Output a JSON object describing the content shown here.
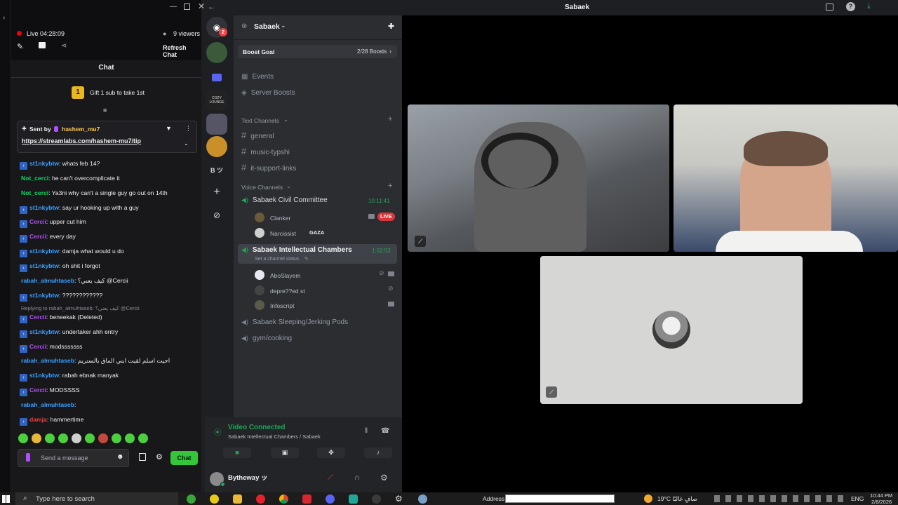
{
  "window": {
    "title": "Sabaek",
    "back_icon": "arrow-left-icon"
  },
  "twitch": {
    "live_label": "Live 04:28:09",
    "viewers": "9 viewers",
    "refresh_chat": "Refresh Chat",
    "chat_header": "Chat",
    "gift_rank": "1",
    "gift_text": "Gift 1 sub to take 1st",
    "pinned": {
      "sent_by": "Sent by",
      "user": "hashem_mu7",
      "link": "https://streamlabs.com/hashem-mu7/tip"
    },
    "messages": [
      {
        "user": "st1nkybtw",
        "color": "blue",
        "badge": true,
        "text": ": whats feb 14?"
      },
      {
        "user": "Not_cerci",
        "color": "green",
        "badge": false,
        "text": ": he can't overcomplicate it"
      },
      {
        "user": "Not_cerci",
        "color": "green",
        "badge": false,
        "text": ": Ya3ni why can't a single guy go out on 14th"
      },
      {
        "user": "st1nkybtw",
        "color": "blue",
        "badge": true,
        "text": ": say ur hooking up with a guy"
      },
      {
        "user": "Cercii",
        "color": "purple",
        "badge": true,
        "text": ": upper cut him"
      },
      {
        "user": "Cercii",
        "color": "purple",
        "badge": true,
        "text": ": every day"
      },
      {
        "user": "st1nkybtw",
        "color": "blue",
        "badge": true,
        "text": ": damja what would u do"
      },
      {
        "user": "st1nkybtw",
        "color": "blue",
        "badge": true,
        "text": ": oh shit i forgot"
      },
      {
        "user": "rabah_almuhtaseb",
        "color": "blue",
        "badge": false,
        "text": ": كيف يعني؟ @Cercii"
      },
      {
        "user": "st1nkybtw",
        "color": "blue",
        "badge": true,
        "text": ": ????????????"
      },
      {
        "user": "Cercii",
        "color": "purple",
        "badge": true,
        "text": ": beneekak (Deleted)"
      },
      {
        "user": "st1nkybtw",
        "color": "blue",
        "badge": true,
        "text": ": undertaker ahh entry"
      },
      {
        "user": "Cercii",
        "color": "purple",
        "badge": true,
        "text": ": modsssssss"
      },
      {
        "user": "rabah_almuhtaseb",
        "color": "blue",
        "badge": false,
        "text": ": اجيت اسلم لقيت ابني الماق بالستريم"
      },
      {
        "user": "st1nkybtw",
        "color": "blue",
        "badge": true,
        "text": ": rabah ebnak manyak"
      },
      {
        "user": "Cercii",
        "color": "purple",
        "badge": true,
        "text": ": MODSSSS"
      },
      {
        "user": "rabah_almuhtaseb",
        "color": "blue",
        "badge": false,
        "text": ":"
      },
      {
        "user": "damja",
        "color": "red",
        "badge": true,
        "text": ": hammertime"
      }
    ],
    "reply_note": "Replying to rabah_almuhtaseb: كيف يعني؟ @Cercii",
    "input_placeholder": "Send a message",
    "chat_button": "Chat"
  },
  "rail": {
    "discord_badge": "2",
    "server_text": "B ツ",
    "cozy_label": "COZY LOUNGE"
  },
  "channels": {
    "server_name": "Sabaek",
    "boost_goal": "Boost Goal",
    "boost_count": "2/28 Boosts",
    "events": "Events",
    "server_boosts": "Server Boosts",
    "text_header": "Text Channels",
    "text": [
      "general",
      "music-typshi",
      "it-support-links"
    ],
    "voice_header": "Voice Channels",
    "vc1": {
      "name": "Sabaek Civil Committee",
      "time": "10:11:41",
      "users": [
        {
          "name": "Clanker",
          "live": "LIVE"
        },
        {
          "name": "Narcissist",
          "tag": "GAZA"
        }
      ]
    },
    "vc2": {
      "name": "Sabaek Intellectual Chambers",
      "time": "1:02:53",
      "status": "Set a channel status",
      "users": [
        "AboSlayem",
        "depre??ed st",
        "Infoscript"
      ]
    },
    "vc3": "Sabaek Sleeping/Jerking Pods",
    "vc4": "gym/cooking",
    "connection": {
      "status": "Video Connected",
      "location": "Sabaek Intellectual Chambers / Sabaek"
    },
    "user": {
      "name": "Bytheway ッ"
    }
  },
  "taskbar": {
    "search_placeholder": "Type here to search",
    "address_label": "Address",
    "weather": "19°C صافٍ غالبًا",
    "lang": "ENG",
    "time": "10:44 PM",
    "date": "2/8/2026"
  },
  "colors": {
    "discord_green": "#23a55a",
    "twitch_purple": "#9147ff",
    "live_red": "#eb0400"
  }
}
